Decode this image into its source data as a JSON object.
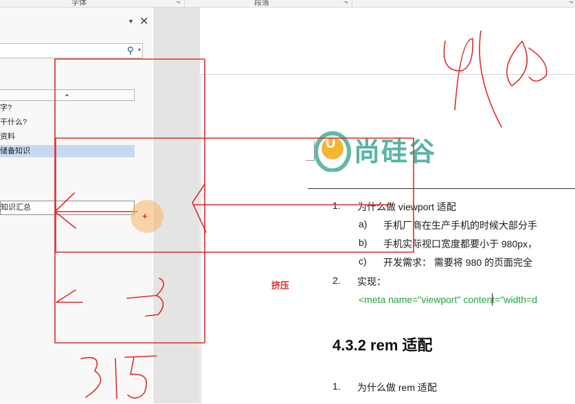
{
  "ribbon": {
    "group_font": "字体",
    "group_paragraph": "段落"
  },
  "nav_pane": {
    "items": [
      {
        "label": "字?"
      },
      {
        "label": "干什么?"
      },
      {
        "label": "资料"
      },
      {
        "label": "储备知识"
      },
      {
        "label": "知识汇总"
      }
    ]
  },
  "logo": {
    "letter": "U",
    "brand": "尚硅谷"
  },
  "document": {
    "items": [
      {
        "marker": "1.",
        "text": "为什么做 viewport 适配"
      },
      {
        "marker": "a)",
        "text": "手机厂商在生产手机的时候大部分手"
      },
      {
        "marker": "b)",
        "text": "手机实际视口宽度都要小于 980px，"
      },
      {
        "marker": "c)",
        "text": "开发需求：  需要将 980 的页面完全"
      },
      {
        "marker": "2.",
        "text": "实现："
      }
    ],
    "code": "<meta name=\"viewport\" content=\"width=d",
    "heading": "4.3.2 rem 适配",
    "item3": {
      "marker": "1.",
      "text": "为什么做 rem 适配"
    }
  },
  "annotations": {
    "squeeze_label": "挤压",
    "number_980": "980",
    "number_375": "375"
  },
  "colors": {
    "annotation_red": "#e02a2a",
    "code_green": "#22a33c",
    "selection_blue": "#c5d9f1",
    "logo_teal": "#56b5a3"
  }
}
